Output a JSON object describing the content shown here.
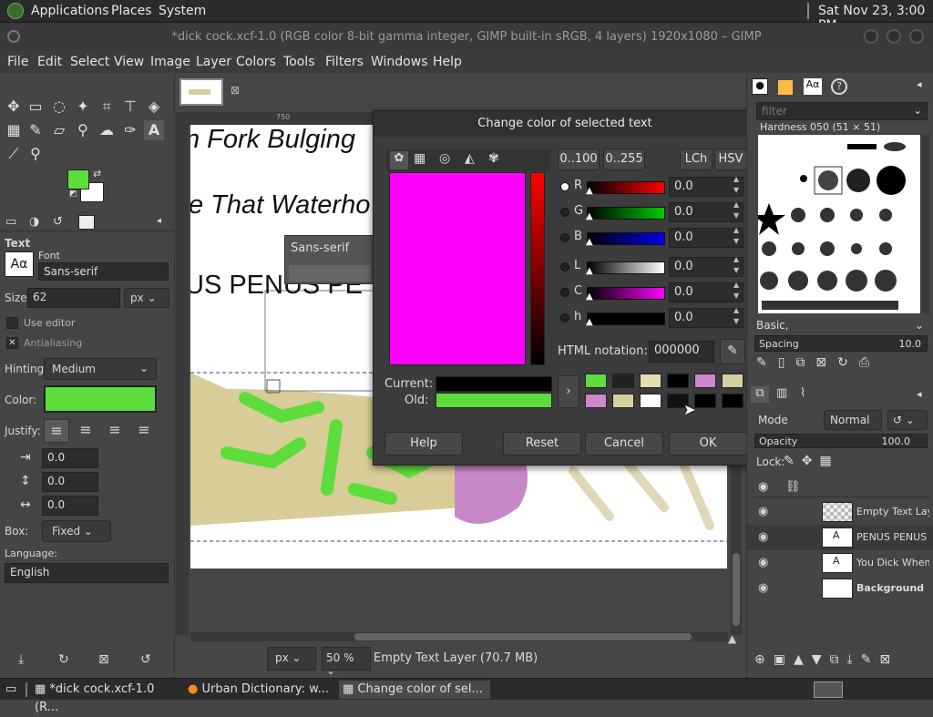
{
  "top_panel": {
    "applications": "Applications",
    "places": "Places",
    "system": "System",
    "clock": "Sat Nov 23,  3:00 PM"
  },
  "window_title": "*dick cock.xcf-1.0 (RGB color 8-bit gamma integer, GIMP built-in sRGB, 4 layers) 1920x1080 – GIMP",
  "menu": [
    "File",
    "Edit",
    "Select",
    "View",
    "Image",
    "Layer",
    "Colors",
    "Tools",
    "Filters",
    "Windows",
    "Help"
  ],
  "text_tool": {
    "header": "Text",
    "font_label": "Font",
    "font_value": "Sans-serif",
    "size_label": "Size:",
    "size_value": "62",
    "size_unit": "px",
    "use_editor": "Use editor",
    "antialiasing": "Antialiasing",
    "hinting_label": "Hinting:",
    "hinting_value": "Medium",
    "color_label": "Color:",
    "color_value": "#5cdd3c",
    "justify_label": "Justify:",
    "spacing_values": [
      "0.0",
      "0.0",
      "0.0"
    ],
    "box_label": "Box:",
    "box_value": "Fixed",
    "language_label": "Language:",
    "language_value": "English"
  },
  "canvas": {
    "ruler_tick": "750",
    "text_lines": [
      "n Fork Bulging",
      "e That Waterho",
      "US PENUS PE"
    ],
    "font_popup": "Sans-serif"
  },
  "dialog": {
    "title": "Change color of selected text",
    "range_buttons": [
      "0..100",
      "0..255"
    ],
    "mode_buttons": [
      "LCh",
      "HSV"
    ],
    "channels": [
      {
        "label": "R",
        "value": "0.0",
        "color": "#ff0000"
      },
      {
        "label": "G",
        "value": "0.0",
        "color": "#00cc00"
      },
      {
        "label": "B",
        "value": "0.0",
        "color": "#0000ee"
      },
      {
        "label": "L",
        "value": "0.0",
        "color": "#ffffff"
      },
      {
        "label": "C",
        "value": "0.0",
        "color": "#ff00ff"
      },
      {
        "label": "h",
        "value": "0.0",
        "color": "#000000"
      }
    ],
    "html_label": "HTML notation:",
    "html_value": "000000",
    "current_label": "Current:",
    "old_label": "Old:",
    "current_color": "#000000",
    "old_color": "#5cdd3c",
    "picker_color": "#ff00ff",
    "history": [
      "#5cdd3c",
      "#222222",
      "#e6deb0",
      "#000000",
      "#cc88cc",
      "#d8d0a0",
      "#cc88cc",
      "#d8d0a0",
      "#ffffff",
      "#111111",
      "#000000",
      "#000000"
    ],
    "buttons": {
      "help": "Help",
      "reset": "Reset",
      "cancel": "Cancel",
      "ok": "OK"
    }
  },
  "status": {
    "unit": "px",
    "zoom": "50 %",
    "layer": "Empty Text Layer (70.7 MB)"
  },
  "right_dock": {
    "filter_placeholder": "filter",
    "brush_name": "Hardness 050 (51 × 51)",
    "preset": "Basic,",
    "spacing_label": "Spacing",
    "spacing_value": "10.0",
    "mode_label": "Mode",
    "mode_value": "Normal",
    "opacity_label": "Opacity",
    "opacity_value": "100.0",
    "lock_label": "Lock:",
    "layers": [
      {
        "name": "Empty Text Layer",
        "bold": false
      },
      {
        "name": "PENUS PENUS P",
        "bold": false
      },
      {
        "name": "You Dick When Y",
        "bold": false
      },
      {
        "name": "Background",
        "bold": true
      }
    ]
  },
  "taskbar": [
    "*dick cock.xcf-1.0 (R...",
    "Urban Dictionary: w...",
    "Change color of sel..."
  ]
}
